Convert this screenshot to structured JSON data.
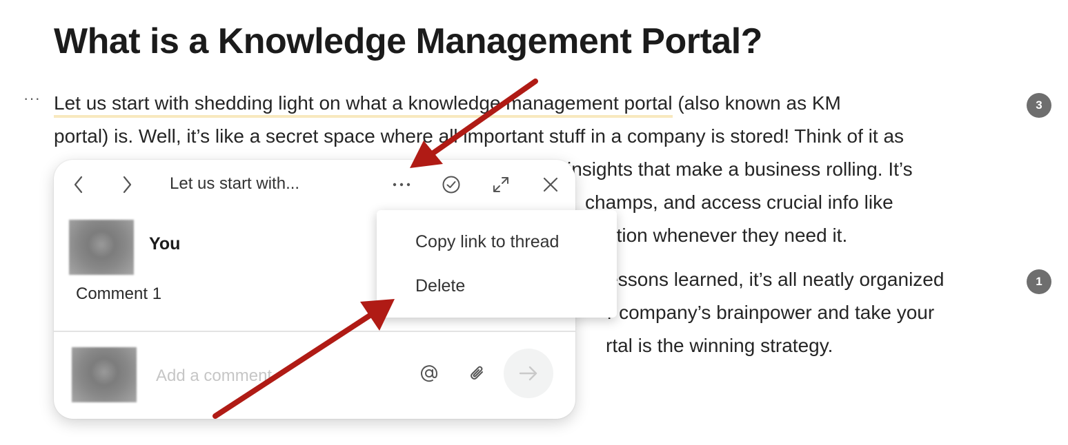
{
  "article": {
    "title": "What is a Knowledge Management Portal?",
    "para1": {
      "highlighted": "Let us start with shedding light on what a knowledge management portal",
      "line1_rest": " (also known as KM",
      "line2": "portal) is. Well, it’s like a secret space where all important stuff in a company is stored! Think of it as",
      "line3_tail": "insights that make a business rolling. It’s",
      "line4_tail": "champs, and access crucial info like",
      "line5_tail": "ation whenever they need it."
    },
    "para2": {
      "line1_tail": "lessons learned, it’s all neatly organized",
      "line2_tail": "r company’s brainpower and take your",
      "line3_tail": "rtal is the winning strategy."
    },
    "badges": [
      "3",
      "1"
    ]
  },
  "comment_panel": {
    "thread_title": "Let us start with...",
    "author": "You",
    "comment": "Comment 1",
    "input_placeholder": "Add a comment"
  },
  "menu": {
    "items": [
      "Copy link to thread",
      "Delete"
    ]
  },
  "colors": {
    "highlight": "#f8e9bf",
    "badge": "#6e6e6e",
    "annotation_arrow": "#b01b15"
  },
  "icons": {
    "block_handle": "more-horizontal-icon",
    "prev": "chevron-left-icon",
    "next": "chevron-right-icon",
    "more": "more-horizontal-icon",
    "resolve": "check-circle-icon",
    "expand": "expand-icon",
    "close": "close-icon",
    "mention": "at-icon",
    "attach": "paperclip-icon",
    "send": "arrow-right-icon"
  }
}
